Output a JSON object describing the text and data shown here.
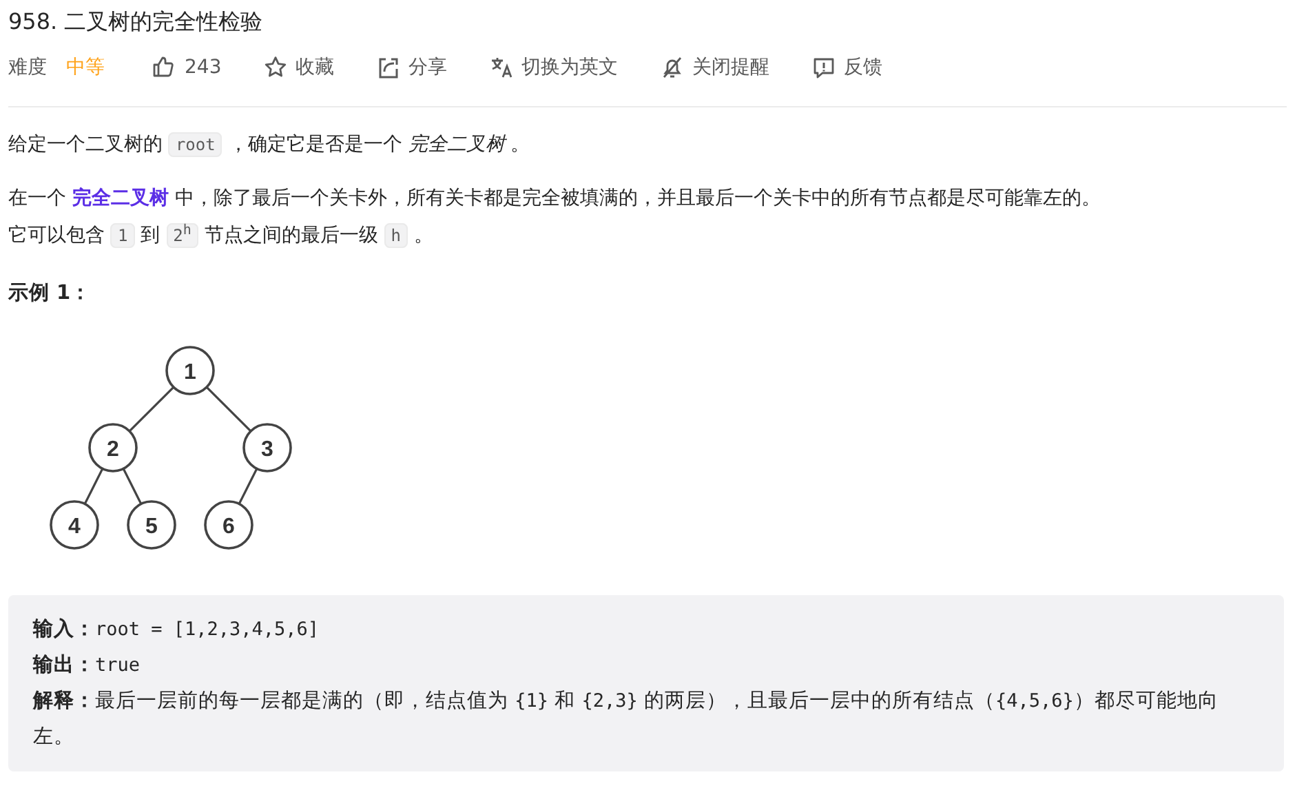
{
  "title": "958. 二叉树的完全性检验",
  "toolbar": {
    "difficulty_label": "难度",
    "difficulty": "中等",
    "actions": [
      {
        "kind": "like",
        "label": "243"
      },
      {
        "kind": "star",
        "label": "收藏"
      },
      {
        "kind": "share",
        "label": "分享"
      },
      {
        "kind": "translate",
        "label": "切换为英文"
      },
      {
        "kind": "bell-off",
        "label": "关闭提醒"
      },
      {
        "kind": "feedback",
        "label": "反馈"
      }
    ]
  },
  "paragraphs": [
    [
      {
        "kind": "text",
        "text": "给定一个二叉树的 "
      },
      {
        "kind": "code",
        "text": "root"
      },
      {
        "kind": "text",
        "text": " ，确定它是否是一个 "
      },
      {
        "kind": "italic",
        "text": "完全二叉树"
      },
      {
        "kind": "text",
        "text": " 。"
      }
    ],
    [
      {
        "kind": "text",
        "text": "在一个 "
      },
      {
        "kind": "link",
        "text": "完全二叉树"
      },
      {
        "kind": "text",
        "text": " 中，除了最后一个关卡外，所有关卡都是完全被填满的，并且最后一个关卡中的所有节点都是尽可能靠左的。"
      },
      {
        "kind": "break"
      },
      {
        "kind": "text",
        "text": "它可以包含 "
      },
      {
        "kind": "code",
        "text": "1"
      },
      {
        "kind": "text",
        "text": " 到 "
      },
      {
        "kind": "code",
        "text": "2$^{h}$"
      },
      {
        "kind": "text",
        "text": " 节点之间的最后一级 "
      },
      {
        "kind": "code",
        "text": "h"
      },
      {
        "kind": "text",
        "text": " 。"
      }
    ]
  ],
  "example_heading": "示例 1：",
  "tree": {
    "value": "1",
    "left": {
      "value": "2",
      "left": {
        "value": "4"
      },
      "right": {
        "value": "5"
      }
    },
    "right": {
      "value": "3",
      "left": {
        "value": "6"
      }
    }
  },
  "example": [
    {
      "label": "输入：",
      "segments": [
        {
          "kind": "code",
          "text": "root = [1,2,3,4,5,6]"
        }
      ]
    },
    {
      "label": "输出：",
      "segments": [
        {
          "kind": "code",
          "text": "true"
        }
      ]
    },
    {
      "label": "解释：",
      "segments": [
        {
          "kind": "text",
          "text": "最后一层前的每一层都是满的（即，结点值为 "
        },
        {
          "kind": "code",
          "text": "{1}"
        },
        {
          "kind": "text",
          "text": " 和 "
        },
        {
          "kind": "code",
          "text": "{2,3}"
        },
        {
          "kind": "text",
          "text": " 的两层），且最后一层中的所有结点（"
        },
        {
          "kind": "code",
          "text": "{4,5,6}"
        },
        {
          "kind": "text",
          "text": "）都尽可能地向左。"
        }
      ]
    }
  ]
}
